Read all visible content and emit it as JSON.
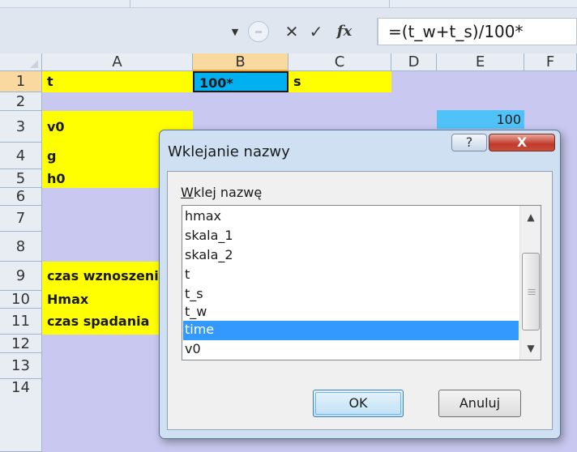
{
  "formula_bar": {
    "formula": "=(t_w+t_s)/100*",
    "cancel_icon": "✕",
    "enter_icon": "✓",
    "fx_icon": "fx",
    "dropdown_icon": "▼"
  },
  "columns": [
    "A",
    "B",
    "C",
    "D",
    "E",
    "F"
  ],
  "rows": [
    "1",
    "2",
    "3",
    "4",
    "5",
    "6",
    "7",
    "8",
    "9",
    "10",
    "11",
    "12",
    "13",
    "14"
  ],
  "cells": {
    "A1": "t",
    "B1": "100*",
    "C1": "s",
    "E2": "100",
    "A3": "v0",
    "A4": "g",
    "A5": "h0",
    "A9": "czas wznoszenia",
    "A10": "Hmax",
    "A11": "czas spadania"
  },
  "dialog": {
    "title": "Wklejanie nazwy",
    "help_icon": "?",
    "close_icon": "X",
    "field_label_mnemonic": "W",
    "field_label_rest": "klej nazwę",
    "list_items": [
      "hmax",
      "skala_1",
      "skala_2",
      "t",
      "t_s",
      "t_w",
      "time",
      "v0"
    ],
    "selected_item": "time",
    "ok_label": "OK",
    "cancel_label": "Anuluj"
  },
  "colors": {
    "sheet_bg": "#c8c8f0",
    "highlight_yellow": "#ffff00",
    "active_cell_blue": "#00b0f0",
    "list_selection": "#3399ff"
  }
}
